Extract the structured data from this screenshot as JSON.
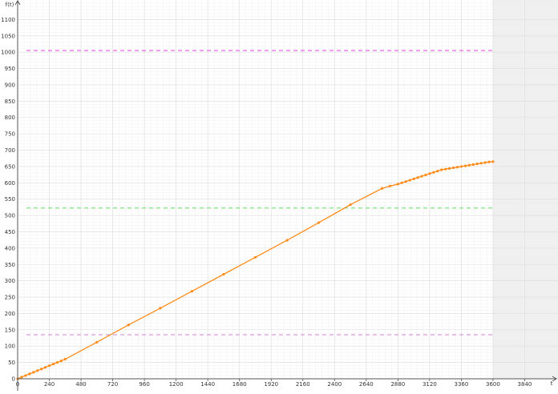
{
  "chart_data": {
    "type": "line",
    "xlabel": "t",
    "ylabel": "f(t)",
    "xlim": [
      0,
      4080
    ],
    "ylim": [
      0,
      1150
    ],
    "x_ticks": [
      0,
      240,
      480,
      720,
      960,
      1200,
      1440,
      1680,
      1920,
      2160,
      2400,
      2640,
      2880,
      3120,
      3360,
      3600,
      3840
    ],
    "y_ticks": [
      0,
      50,
      100,
      150,
      200,
      250,
      300,
      350,
      400,
      450,
      500,
      550,
      600,
      650,
      700,
      750,
      800,
      850,
      900,
      950,
      1000,
      1050,
      1100
    ],
    "grid": true,
    "data_region_end_x": 3600,
    "series": [
      {
        "color": "#ff8c1a",
        "x": [
          0,
          30,
          60,
          90,
          120,
          150,
          180,
          210,
          240,
          270,
          300,
          330,
          360,
          600,
          840,
          1080,
          1320,
          1560,
          1800,
          2040,
          2280,
          2520,
          2760,
          2820,
          2880,
          2910,
          2940,
          2970,
          3000,
          3030,
          3060,
          3090,
          3120,
          3150,
          3180,
          3210,
          3240,
          3270,
          3300,
          3330,
          3360,
          3390,
          3420,
          3450,
          3480,
          3510,
          3540,
          3570,
          3600
        ],
        "y": [
          0,
          5,
          10,
          15,
          20,
          25,
          30,
          35,
          40,
          45,
          50,
          55,
          60,
          112,
          165,
          216,
          268,
          320,
          372,
          424,
          478,
          533,
          583,
          590,
          596,
          600,
          604,
          608,
          612,
          616,
          620,
          624,
          628,
          632,
          636,
          640,
          642,
          644,
          646,
          648,
          650,
          652,
          654,
          656,
          658,
          660,
          662,
          664,
          665
        ]
      }
    ],
    "reference_lines": [
      {
        "y": 1005,
        "color": "#e040e0"
      },
      {
        "y": 523,
        "color": "#66dd66"
      },
      {
        "y": 135,
        "color": "#d080d0"
      },
      {
        "y": 0,
        "color": "#c020c0"
      }
    ]
  }
}
